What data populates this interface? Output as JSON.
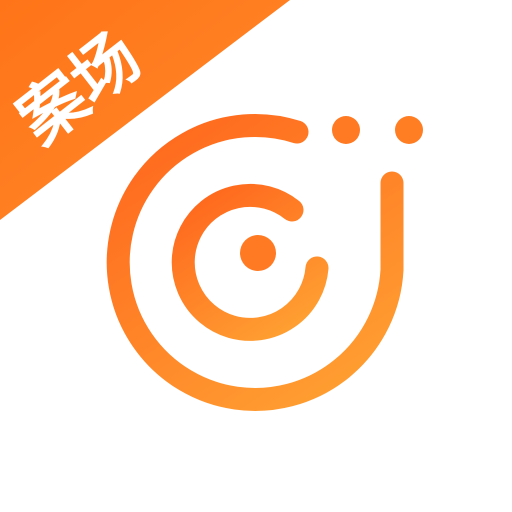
{
  "corner_badge": {
    "label": "案场",
    "background_color": "#FF7A1F"
  },
  "logo": {
    "icon_name": "orange-snail-swirl-logo",
    "gradient_start_color": "#FF6A1E",
    "gradient_end_color": "#FFA032"
  }
}
